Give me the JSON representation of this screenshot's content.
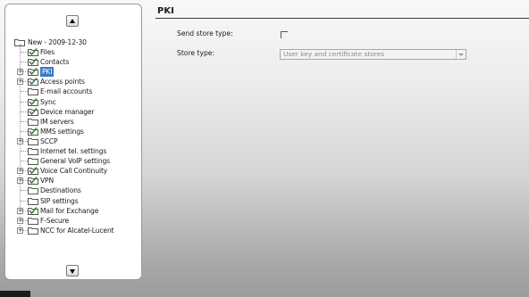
{
  "tree": {
    "root_label": "New - 2009-12-30",
    "items": [
      {
        "label": "Files",
        "expandable": false,
        "checked": true
      },
      {
        "label": "Contacts",
        "expandable": false,
        "checked": true
      },
      {
        "label": "PKI",
        "expandable": true,
        "checked": true,
        "selected": true
      },
      {
        "label": "Access points",
        "expandable": true,
        "checked": true
      },
      {
        "label": "E-mail accounts",
        "expandable": false,
        "checked": false
      },
      {
        "label": "Sync",
        "expandable": false,
        "checked": true
      },
      {
        "label": "Device manager",
        "expandable": false,
        "checked": true
      },
      {
        "label": "IM servers",
        "expandable": false,
        "checked": false
      },
      {
        "label": "MMS settings",
        "expandable": false,
        "checked": true
      },
      {
        "label": "SCCP",
        "expandable": true,
        "checked": false
      },
      {
        "label": "Internet tel. settings",
        "expandable": false,
        "checked": false
      },
      {
        "label": "General VoIP settings",
        "expandable": false,
        "checked": false
      },
      {
        "label": "Voice Call Continuity",
        "expandable": true,
        "checked": true
      },
      {
        "label": "VPN",
        "expandable": true,
        "checked": true
      },
      {
        "label": "Destinations",
        "expandable": false,
        "checked": false
      },
      {
        "label": "SIP settings",
        "expandable": false,
        "checked": false
      },
      {
        "label": "Mail for Exchange",
        "expandable": true,
        "checked": true
      },
      {
        "label": "F-Secure",
        "expandable": true,
        "checked": false
      },
      {
        "label": "NCC for Alcatel-Lucent",
        "expandable": true,
        "checked": false
      }
    ]
  },
  "panel": {
    "title": "PKI",
    "send_store_type_label": "Send store type:",
    "send_store_type_checked": false,
    "store_type_label": "Store type:",
    "store_type_value": "User key and certificate stores"
  },
  "colors": {
    "selection": "#3b78c9",
    "check": "#2e7d2e"
  }
}
